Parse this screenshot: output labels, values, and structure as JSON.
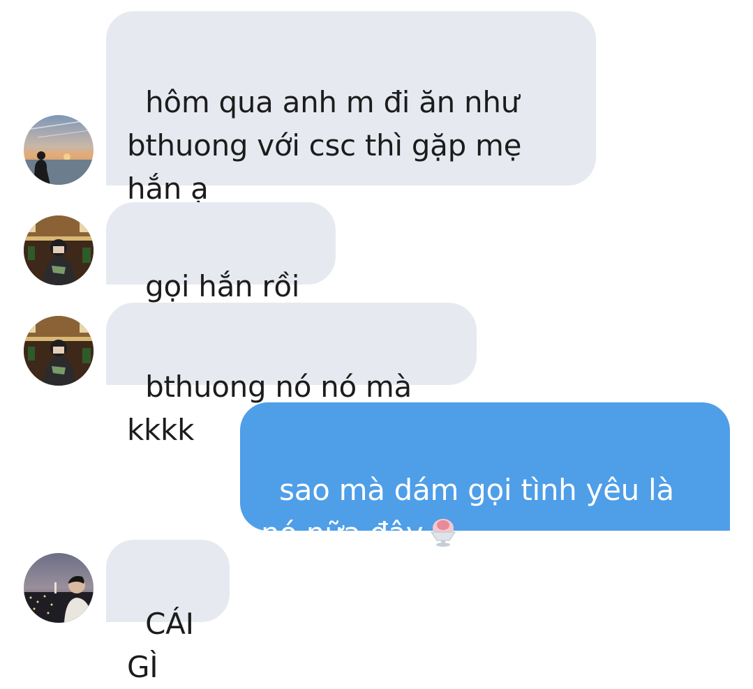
{
  "messages": [
    {
      "direction": "incoming",
      "sender_avatar": "avatar-sunset-sea",
      "text": "hôm qua anh m đi ăn như bthuong với csc thì gặp mẹ hắn ạ"
    },
    {
      "direction": "incoming",
      "sender_avatar": "avatar-library-hoodie",
      "text": "gọi hắn rồi hả"
    },
    {
      "direction": "incoming",
      "sender_avatar": "avatar-library-hoodie",
      "text": "bthuong nó nó mà kkkk"
    },
    {
      "direction": "outgoing",
      "text": "sao mà dám gọi tình yêu là nó nữa đây",
      "emoji": "shaved-ice-icon"
    },
    {
      "direction": "incoming",
      "sender_avatar": "avatar-night-city",
      "text": "CÁI GÌ"
    }
  ],
  "colors": {
    "incoming_bubble": "#e6eaf0",
    "outgoing_bubble": "#4f9ee8",
    "incoming_text": "#1c1c1c",
    "outgoing_text": "#ffffff",
    "background": "#ffffff"
  }
}
